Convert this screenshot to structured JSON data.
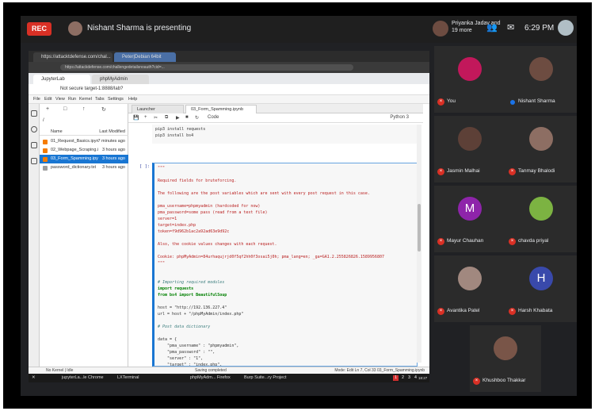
{
  "meet": {
    "rec_label": "REC",
    "presenting_text": "Nishant Sharma is presenting",
    "host_text": "Priyanka Jadav and 19 more",
    "people_icon": "people-icon",
    "chat_icon": "chat-icon",
    "time": "6:29 PM"
  },
  "browser": {
    "outer_tabs": [
      "https://attacktdefense.com/chal...",
      "Peter|Debian 64bit"
    ],
    "outer_url": "https://attackdefense.com/challengedetailsnoauth?cid=...",
    "inner_tabs": [
      "JupyterLab",
      "phpMyAdmin"
    ],
    "inner_url": "Not secure  target-1:8888/lab?",
    "menu": [
      "File",
      "Edit",
      "View",
      "Run",
      "Kernel",
      "Tabs",
      "Settings",
      "Help"
    ]
  },
  "filebrowser": {
    "crumb": "/",
    "col_name": "Name",
    "col_modified": "Last Modified",
    "files": [
      {
        "name": "01_Request_Basics.ipynb",
        "modified": "7 minutes ago"
      },
      {
        "name": "02_Webpage_Scraping.i...",
        "modified": "3 hours ago"
      },
      {
        "name": "03_Form_Spamming.ipy...",
        "modified": "3 hours ago"
      },
      {
        "name": "password_dictionary.txt",
        "modified": "3 hours ago"
      }
    ]
  },
  "editor": {
    "tabs": [
      "Launcher",
      "03_Form_Spamming.ipynb"
    ],
    "cell_type": "Code",
    "kernel": "Python 3",
    "code_top": [
      "pip3 install requests",
      "pip3 install bs4"
    ],
    "prompt": "[ ]:",
    "cell_lines": [
      {
        "t": "\"\"\"",
        "c": "s"
      },
      {
        "t": "",
        "c": "s"
      },
      {
        "t": "Required fields for bruteforcing.",
        "c": "s"
      },
      {
        "t": "",
        "c": "s"
      },
      {
        "t": "The following are the post variables which are sent with every post request in this case.",
        "c": "s"
      },
      {
        "t": "",
        "c": "s"
      },
      {
        "t": "pma_username=phpmyadmin (hardcoded for now)",
        "c": "s"
      },
      {
        "t": "pma_password=some pass (read from a text file)",
        "c": "s"
      },
      {
        "t": "server=1",
        "c": "s"
      },
      {
        "t": "target=index.php",
        "c": "s"
      },
      {
        "t": "token=f9d962b1ac2a92ad63e9d92c",
        "c": "s"
      },
      {
        "t": "",
        "c": "s"
      },
      {
        "t": "Also, the cookie values changes with each request.",
        "c": "s"
      },
      {
        "t": "",
        "c": "s"
      },
      {
        "t": "Cookie: phpMyAdmin=84urhaqujrjd0f5qf2hh0f3osai5j0h; pma_lang=en; _ga=GA1.2.255826826.1589956807",
        "c": "s"
      },
      {
        "t": "\"\"\"",
        "c": "s"
      },
      {
        "t": "",
        "c": "s"
      },
      {
        "t": "",
        "c": "s"
      },
      {
        "t": "# Importing required modules",
        "c": "cm"
      },
      {
        "t": "import requests",
        "c": "kw"
      },
      {
        "t": "from bs4 import BeautifulSoup",
        "c": "kw"
      },
      {
        "t": "",
        "c": "nm"
      },
      {
        "t": "host = \"http://192.136.227.4\"",
        "c": "nm"
      },
      {
        "t": "url = host + \"/phpMyAdmin/index.php\"",
        "c": "nm"
      },
      {
        "t": "",
        "c": "nm"
      },
      {
        "t": "# Post data dictionary",
        "c": "cm"
      },
      {
        "t": "",
        "c": "nm"
      },
      {
        "t": "data = {",
        "c": "nm"
      },
      {
        "t": "    \"pma_username\" : \"phpmyadmin\",",
        "c": "nm"
      },
      {
        "t": "    \"pma_password\" : \"\",",
        "c": "nm"
      },
      {
        "t": "    \"server\" : \"1\",",
        "c": "nm"
      },
      {
        "t": "    \"target\" : \"index.php\",",
        "c": "nm"
      }
    ]
  },
  "status": {
    "left": "No Kernel | Idle",
    "center": "Saving completed",
    "right": "Mode: Edit    Ln 7, Col 33    03_Form_Spamming.ipynb"
  },
  "taskbar": {
    "items": [
      "jupyterLa...le Chrome",
      "LXTerminal",
      "phpMyAdm... Firefox",
      "Burp Suite...ry Project"
    ],
    "workspaces": [
      "1",
      "2",
      "3",
      "4"
    ],
    "clock": "18:27"
  },
  "participants": [
    {
      "name": "You",
      "muted": true,
      "color": "#c2185b"
    },
    {
      "name": "Nishant Sharma",
      "muted": false,
      "color": "#6d4c41"
    },
    {
      "name": "Jasmin Malhai",
      "muted": true,
      "color": "#5d4037"
    },
    {
      "name": "Tanmay Bhalodi",
      "muted": true,
      "color": "#8d6e63"
    },
    {
      "name": "Mayur Chauhan",
      "muted": true,
      "color": "#8e24aa",
      "initial": "M"
    },
    {
      "name": "chavda priyal",
      "muted": true,
      "color": "#7cb342"
    },
    {
      "name": "Avantika Patel",
      "muted": true,
      "color": "#a1887f"
    },
    {
      "name": "Harsh Khabata",
      "muted": true,
      "color": "#3949ab",
      "initial": "H"
    },
    {
      "name": "Khushboo Thakkar",
      "muted": true,
      "color": "#795548"
    }
  ]
}
